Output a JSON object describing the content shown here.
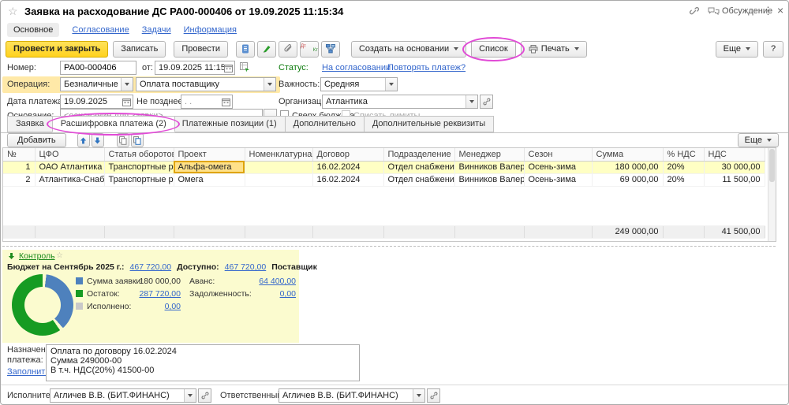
{
  "colors": {
    "annotation": "#e14bd6",
    "accent_button": "#ffd21e",
    "status_green": "#0a7a0a",
    "link_blue": "#3366cc",
    "row_highlight": "#ffffc4",
    "control_bg": "#fbfbcf"
  },
  "window": {
    "title": "Заявка на расходование ДС РА00-000406 от 19.09.2025 11:15:34",
    "discussion": "Обсуждение",
    "menu_dots": "⋮",
    "close": "×",
    "star": "☆"
  },
  "nav": {
    "items": [
      {
        "label": "Основное"
      },
      {
        "label": "Согласование"
      },
      {
        "label": "Задачи"
      },
      {
        "label": "Информация"
      }
    ]
  },
  "toolbar": {
    "post_close": "Провести и закрыть",
    "save": "Записать",
    "post": "Провести",
    "dt": "Дт",
    "kt": "Кт",
    "create_based": "Создать на основании",
    "list": "Список",
    "print": "Печать",
    "more": "Еще",
    "help": "?"
  },
  "fields": {
    "number_label": "Номер:",
    "number": "РА00-000406",
    "from_label": "от:",
    "datetime": "19.09.2025 11:15:34",
    "operation_label": "Операция:",
    "operation": "Безналичные",
    "operation_kind": "Оплата поставщику",
    "paydate_label": "Дата платежа:",
    "paydate": "19.09.2025",
    "notlater_label": "Не позднее:",
    "notlater": ". .",
    "basis_label": "Основание:",
    "basis_placeholder": "<основание для заявки>",
    "basis_picker": "...",
    "status_label": "Статус:",
    "status": "На согласовании",
    "repeat_link": "Повторять платеж?",
    "importance_label": "Важность:",
    "importance": "Средняя",
    "org_label": "Организация:",
    "org": "Атлантика",
    "over_budget": "Сверх бюджета",
    "writeoff_limits": "Списать лимиты"
  },
  "tabs": [
    {
      "label": "Заявка"
    },
    {
      "label": "Расшифровка платежа (2)"
    },
    {
      "label": "Платежные позиции (1)"
    },
    {
      "label": "Дополнительно"
    },
    {
      "label": "Дополнительные реквизиты"
    }
  ],
  "grid": {
    "add": "Добавить",
    "more": "Еще",
    "columns": [
      "№",
      "ЦФО",
      "Статья оборотов",
      "Проект",
      "Номенклатурная группа",
      "Договор",
      "Подразделение",
      "Менеджер",
      "Сезон",
      "Сумма",
      "% НДС",
      "НДС"
    ],
    "rows": [
      [
        "1",
        "ОАО Атлантика",
        "Транспортные расходы",
        "Альфа-омега",
        "",
        "16.02.2024",
        "Отдел снабжения",
        "Винников Валерий Вал...",
        "Осень-зима",
        "180 000,00",
        "20%",
        "30 000,00"
      ],
      [
        "2",
        "Атлантика-Снабжение",
        "Транспортные расходы",
        "Омега",
        "",
        "16.02.2024",
        "Отдел снабжения",
        "Винников Валерий Вал...",
        "Осень-зима",
        "69 000,00",
        "20%",
        "11 500,00"
      ]
    ],
    "totals": {
      "sum": "249 000,00",
      "vat": "41 500,00"
    }
  },
  "control": {
    "title": "Контроль",
    "budget_label": "Бюджет на Сентябрь 2025 г.:",
    "budget_value": "467 720,00",
    "available_label": "Доступно:",
    "available_value": "467 720,00",
    "supplier_header": "Поставщик",
    "request_label": "Сумма заявки:",
    "request_value": "180 000,00",
    "rest_label": "Остаток:",
    "rest_value": "287 720,00",
    "done_label": "Исполнено:",
    "done_value": "0,00",
    "advance_label": "Аванс:",
    "advance_value": "64 400,00",
    "debt_label": "Задолженность:",
    "debt_value": "0,00",
    "chart": {
      "type": "pie",
      "gap_color": "#fbfbcf",
      "slices": [
        {
          "name": "Сумма заявки",
          "value": 180000,
          "color": "#4e81bd"
        },
        {
          "name": "Остаток",
          "value": 287720,
          "color": "#169b22"
        },
        {
          "name": "Исполнено",
          "value": 0,
          "color": "#c9c9c9"
        }
      ]
    }
  },
  "purpose": {
    "label": "Назначение платежа:",
    "fill_link": "Заполнить",
    "text": "Оплата по договору 16.02.2024\nСумма 249000-00\nВ т.ч. НДС(20%) 41500-00"
  },
  "footer": {
    "executor_label": "Исполнитель:",
    "executor": "Агличев В.В. (БИТ.ФИНАНС)",
    "responsible_label": "Ответственный:",
    "responsible": "Агличев В.В. (БИТ.ФИНАНС)"
  }
}
